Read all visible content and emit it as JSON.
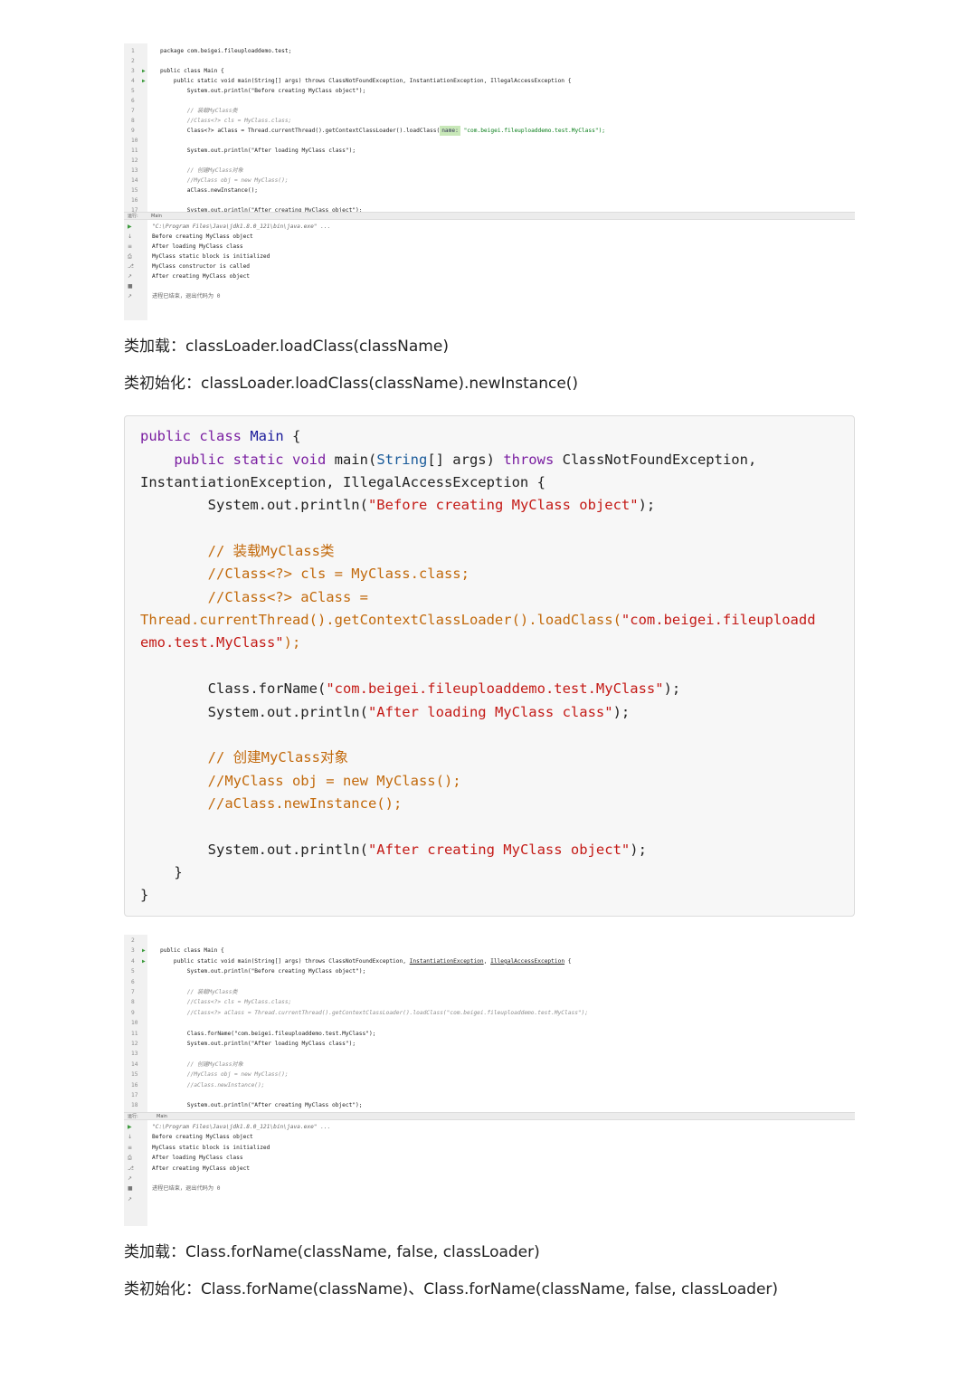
{
  "ide1": {
    "code_lines": [
      {
        "n": "1",
        "text": "package com.beigei.fileuploaddemo.test;"
      },
      {
        "n": "2",
        "text": ""
      },
      {
        "n": "3",
        "text": "public class Main {"
      },
      {
        "n": "4",
        "text": "    public static void main(String[] args) throws ClassNotFoundException, InstantiationException, IllegalAccessException {"
      },
      {
        "n": "5",
        "text": "        System.out.println(\"Before creating MyClass object\");"
      },
      {
        "n": "6",
        "text": ""
      },
      {
        "n": "7",
        "text": "        // 装载MyClass类"
      },
      {
        "n": "8",
        "text": "        //Class<?> cls = MyClass.class;"
      },
      {
        "n": "9",
        "pre": "        Class<?> aClass = Thread.currentThread().getContextClassLoader().loadClass(",
        "hint": "name:",
        "post": " \"com.beigei.fileuploaddemo.test.MyClass\");"
      },
      {
        "n": "10",
        "text": ""
      },
      {
        "n": "11",
        "text": "        System.out.println(\"After loading MyClass class\");"
      },
      {
        "n": "12",
        "text": ""
      },
      {
        "n": "13",
        "text": "        // 创建MyClass对象"
      },
      {
        "n": "14",
        "text": "        //MyClass obj = new MyClass();"
      },
      {
        "n": "15",
        "text": "        aClass.newInstance();"
      },
      {
        "n": "16",
        "text": ""
      },
      {
        "n": "17",
        "text": "        System.out.println(\"After creating MyClass object\");"
      }
    ],
    "run_tab_label": "运行:",
    "run_tab_name": "Main",
    "output": [
      "\"C:\\Program Files\\Java\\jdk1.8.0_121\\bin\\java.exe\" ...",
      "Before creating MyClass object",
      "After loading MyClass class",
      "MyClass static block is initialized",
      "MyClass constructor is called",
      "After creating MyClass object",
      "",
      "进程已结束，退出代码为 0"
    ]
  },
  "para1": "类加载：classLoader.loadClass(className)",
  "para2": "类初始化：classLoader.loadClass(className).newInstance()",
  "codeblock": {
    "l1_a": "public class ",
    "l1_b": "Main",
    "l1_c": " {",
    "l2_a": "    public static ",
    "l2_b": "void",
    "l2_c": " main(",
    "l2_d": "String",
    "l2_e": "[] args) ",
    "l2_f": "throws",
    "l2_g": " ClassNotFoundException,",
    "l3": "InstantiationException, IllegalAccessException {",
    "l4_a": "        System.out.println(",
    "l4_b": "\"Before creating MyClass object\"",
    "l4_c": ");",
    "l5": "        // 装载MyClass类",
    "l6": "        //Class<?> cls = MyClass.class;",
    "l7": "        //Class<?> aClass =",
    "l8_a": "Thread.currentThread().getContextClassLoader().loadClass(",
    "l8_b": "\"com.beigei.fileuploadd",
    "l9_a": "emo.test.MyClass\"",
    "l9_b": ");",
    "l10_a": "        Class.forName(",
    "l10_b": "\"com.beigei.fileuploaddemo.test.MyClass\"",
    "l10_c": ");",
    "l11_a": "        System.out.println(",
    "l11_b": "\"After loading MyClass class\"",
    "l11_c": ");",
    "l12": "        // 创建MyClass对象",
    "l13": "        //MyClass obj = new MyClass();",
    "l14": "        //aClass.newInstance();",
    "l15_a": "        System.out.println(",
    "l15_b": "\"After creating MyClass object\"",
    "l15_c": ");",
    "l16": "    }",
    "l17": "}"
  },
  "ide2": {
    "code_lines": [
      {
        "n": "2",
        "text": ""
      },
      {
        "n": "3",
        "text": "public class Main {"
      },
      {
        "n": "4",
        "pre": "    public static void main(String[] args) throws ClassNotFoundException, ",
        "u1": "InstantiationException",
        "mid": ", ",
        "u2": "IllegalAccessException",
        "post": " {"
      },
      {
        "n": "5",
        "text": "        System.out.println(\"Before creating MyClass object\");"
      },
      {
        "n": "6",
        "text": ""
      },
      {
        "n": "7",
        "text": "        // 装载MyClass类"
      },
      {
        "n": "8",
        "text": "        //Class<?> cls = MyClass.class;"
      },
      {
        "n": "9",
        "text": "        //Class<?> aClass = Thread.currentThread().getContextClassLoader().loadClass(\"com.beigei.fileuploaddemo.test.MyClass\");"
      },
      {
        "n": "10",
        "text": ""
      },
      {
        "n": "11",
        "text": "        Class.forName(\"com.beigei.fileuploaddemo.test.MyClass\");"
      },
      {
        "n": "12",
        "text": "        System.out.println(\"After loading MyClass class\");"
      },
      {
        "n": "13",
        "text": ""
      },
      {
        "n": "14",
        "text": "        // 创建MyClass对象"
      },
      {
        "n": "15",
        "text": "        //MyClass obj = new MyClass();"
      },
      {
        "n": "16",
        "text": "        //aClass.newInstance();"
      },
      {
        "n": "17",
        "text": ""
      },
      {
        "n": "18",
        "text": "        System.out.println(\"After creating MyClass object\");"
      }
    ],
    "run_tab_label": "运行:",
    "run_tab_name": "Main",
    "output": [
      "\"C:\\Program Files\\Java\\jdk1.8.0_121\\bin\\java.exe\" ...",
      "Before creating MyClass object",
      "MyClass static block is initialized",
      "After loading MyClass class",
      "After creating MyClass object",
      "",
      "进程已结束，退出代码为 0"
    ]
  },
  "para3": "类加载：Class.forName(className, false, classLoader)",
  "para4": "类初始化：Class.forName(className)、Class.forName(className, false, classLoader)"
}
